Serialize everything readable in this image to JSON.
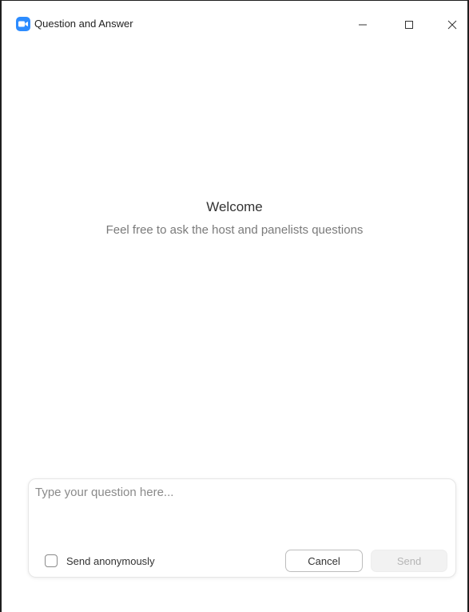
{
  "window": {
    "title": "Question and Answer",
    "app_icon": "zoom-camera-icon",
    "controls": [
      "minimize-icon",
      "maximize-icon",
      "close-icon"
    ]
  },
  "welcome": {
    "title": "Welcome",
    "subtitle": "Feel free to ask the host and panelists questions"
  },
  "compose": {
    "placeholder": "Type your question here...",
    "value": "",
    "anonymous_label": "Send anonymously",
    "anonymous_checked": false,
    "cancel_label": "Cancel",
    "send_label": "Send",
    "send_enabled": false
  },
  "colors": {
    "accent": "#2d8cff",
    "disabled_button_bg": "#f2f2f2",
    "disabled_button_text": "#b5b5b5"
  }
}
